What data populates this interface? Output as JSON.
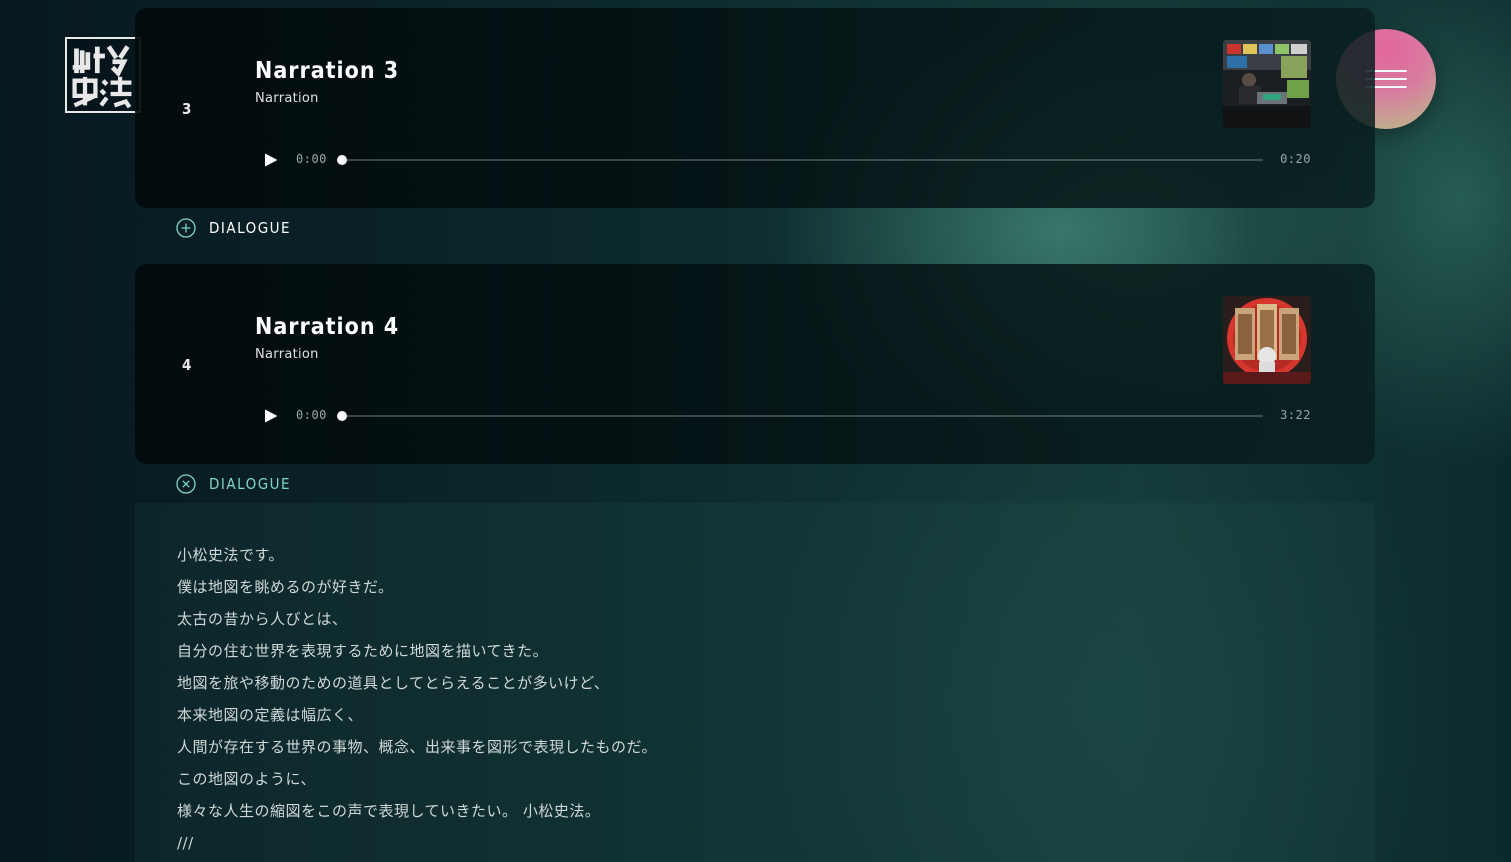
{
  "logo": {
    "text": "小松史法"
  },
  "menu": {
    "icon": "hamburger-icon"
  },
  "tracks": [
    {
      "number": "3",
      "title": "Narration 3",
      "subtitle": "Narration",
      "player": {
        "current": "0:00",
        "total": "0:20",
        "progress": 0
      },
      "thumbnail": "studio-monitors-photo",
      "dialogue_label": "DIALOGUE",
      "dialogue_icon": "plus-circle-icon"
    },
    {
      "number": "4",
      "title": "Narration 4",
      "subtitle": "Narration",
      "player": {
        "current": "0:00",
        "total": "3:22",
        "progress": 0
      },
      "thumbnail": "triptych-screens-photo",
      "dialogue_label": "DIALOGUE",
      "dialogue_icon": "close-circle-icon"
    }
  ],
  "dialogue": {
    "lines": [
      "小松史法です。",
      "僕は地図を眺めるのが好きだ。",
      "太古の昔から人びとは、",
      "自分の住む世界を表現するために地図を描いてきた。",
      "地図を旅や移動のための道具としてとらえることが多いけど、",
      "本来地図の定義は幅広く、",
      "人間が存在する世界の事物、概念、出来事を図形で表現したものだ。",
      "この地図のように、",
      "様々な人生の縮図をこの声で表現していきたい。 小松史法。",
      "///"
    ]
  },
  "colors": {
    "accent_teal": "#7fd6c6",
    "menu_pink": "#e2679b",
    "menu_green": "#b8c087"
  }
}
